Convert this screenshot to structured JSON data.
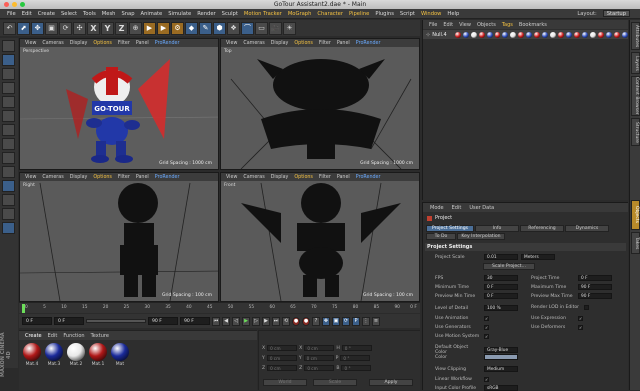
{
  "window": {
    "title": "GoTour Assistant2.dae * - Main"
  },
  "menu": [
    "File",
    "Edit",
    "Create",
    "Select",
    "Tools",
    "Mesh",
    "Snap",
    "Animate",
    "Simulate",
    "Render",
    "Sculpt",
    "Motion Tracker",
    "MoGraph",
    "Character",
    "Pipeline",
    "Plugins",
    "Script",
    "Window",
    "Help"
  ],
  "menu_highlight": [
    "Motion Tracker",
    "MoGraph",
    "Character",
    "Pipeline",
    "Window"
  ],
  "layout": {
    "label": "Layout:",
    "value": "Startup"
  },
  "toolbar_letters": [
    "X",
    "Y",
    "Z"
  ],
  "viewports": [
    {
      "label": "Perspective",
      "menu": [
        "View",
        "Cameras",
        "Display",
        "Options",
        "Filter",
        "Panel",
        "ProRender"
      ],
      "grid": "Grid Spacing : 1000 cm",
      "logo_text": "GO-TOUR"
    },
    {
      "label": "Top",
      "menu": [
        "View",
        "Cameras",
        "Display",
        "Options",
        "Filter",
        "Panel",
        "ProRender"
      ],
      "grid": "Grid Spacing : 1000 cm"
    },
    {
      "label": "Right",
      "menu": [
        "View",
        "Cameras",
        "Display",
        "Options",
        "Filter",
        "Panel",
        "ProRender"
      ],
      "grid": "Grid Spacing : 100 cm"
    },
    {
      "label": "Front",
      "menu": [
        "View",
        "Cameras",
        "Display",
        "Options",
        "Filter",
        "Panel",
        "ProRender"
      ],
      "grid": "Grid Spacing : 100 cm"
    }
  ],
  "timeline": {
    "ticks": [
      "0",
      "5",
      "10",
      "15",
      "20",
      "25",
      "30",
      "35",
      "40",
      "45",
      "50",
      "55",
      "60",
      "65",
      "70",
      "75",
      "80",
      "85",
      "90"
    ],
    "end_label": "0 F"
  },
  "transport": {
    "current": "0 F",
    "start": "0 F",
    "end": "90 F",
    "end2": "90 F"
  },
  "material_manager": {
    "menu": [
      "Create",
      "Edit",
      "Function",
      "Texture"
    ],
    "materials": [
      {
        "name": "Mat.4",
        "color": "#b01818"
      },
      {
        "name": "Mat.3",
        "color": "#1a2a9a"
      },
      {
        "name": "Mat.2",
        "color": "#e8e8e8"
      },
      {
        "name": "Mat.1",
        "color": "#b01818"
      },
      {
        "name": "Mat",
        "color": "#1a2a9a"
      }
    ]
  },
  "coordinates": {
    "rows": [
      {
        "a": "X",
        "av": "0 cm",
        "b": "X",
        "bv": "0 cm",
        "c": "H",
        "cv": "0 °"
      },
      {
        "a": "Y",
        "av": "0 cm",
        "b": "Y",
        "bv": "0 cm",
        "c": "P",
        "cv": "0 °"
      },
      {
        "a": "Z",
        "av": "0 cm",
        "b": "Z",
        "bv": "0 cm",
        "c": "B",
        "cv": "0 °"
      }
    ],
    "mode1": "World",
    "mode2": "Scale",
    "apply": "Apply"
  },
  "object_manager": {
    "menu": [
      "File",
      "Edit",
      "View",
      "Objects",
      "Tags",
      "Bookmarks"
    ],
    "highlight": "Tags",
    "null_name": "Null.4",
    "tag_colors": [
      "#d02020",
      "#3050c0",
      "#e8e8e8",
      "#d02020",
      "#3050c0",
      "#d02020",
      "#3050c0",
      "#e8e8e8",
      "#d02020",
      "#3050c0",
      "#d02020",
      "#3050c0",
      "#e8e8e8",
      "#d02020",
      "#3050c0",
      "#d02020",
      "#3050c0",
      "#e8e8e8",
      "#d02020",
      "#3050c0",
      "#d02020",
      "#3050c0"
    ]
  },
  "attributes": {
    "menu": [
      "Mode",
      "Edit",
      "User Data"
    ],
    "object": "Project",
    "tabs_row1": [
      "Project Settings",
      "Info",
      "Referencing",
      "Dynamics"
    ],
    "tabs_row2": [
      "To Do",
      "Key Interpolation"
    ],
    "section": "Project Settings",
    "scale_label": "Project Scale",
    "scale_value": "0.01",
    "scale_unit": "Meters",
    "scale_button": "Scale Project...",
    "left_params": [
      {
        "label": "FPS",
        "value": "30"
      },
      {
        "label": "Minimum Time",
        "value": "0 F"
      },
      {
        "label": "Preview Min Time",
        "value": "0 F"
      }
    ],
    "right_params": [
      {
        "label": "Project Time",
        "value": "0 F"
      },
      {
        "label": "Maximum Time",
        "value": "90 F"
      },
      {
        "label": "Preview Max Time",
        "value": "90 F"
      }
    ],
    "lod_label": "Level of Detail",
    "lod_value": "100 %",
    "render_lod_label": "Render LOD in Editor",
    "checks_left": [
      "Use Animation",
      "Use Generators",
      "Use Motion System"
    ],
    "checks_right": [
      "Use Expression",
      "Use Deformers"
    ],
    "default_color_label": "Default Object Color",
    "default_color_value": "Gray-Blue",
    "color_label": "Color",
    "view_clipping_label": "View Clipping",
    "view_clipping_value": "Medium",
    "linear_workflow_label": "Linear Workflow",
    "input_color_label": "Input Color Profile",
    "input_color_value": "sRGB"
  },
  "right_tabs": [
    "Attributes",
    "Layers",
    "Content Browser",
    "Structure",
    "Objects",
    "Takes"
  ],
  "sidebar_brand": "MAXON CINEMA 4D"
}
